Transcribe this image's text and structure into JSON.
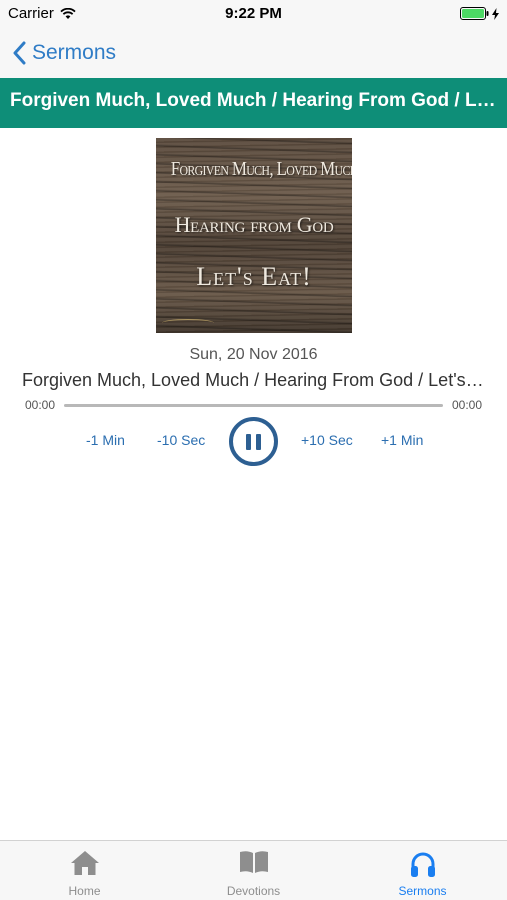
{
  "status_bar": {
    "carrier": "Carrier",
    "time": "9:22 PM",
    "battery_color": "#4cd964"
  },
  "nav": {
    "back_label": "Sermons",
    "accent_color": "#2f7cc6"
  },
  "banner": {
    "title": "Forgiven Much, Loved Much / Hearing From God / Let's Eat!",
    "background_color": "#0e8e78"
  },
  "artwork": {
    "line_1": "Forgiven Much, Loved Much",
    "line_2": "Hearing from God",
    "line_3": "Let's Eat!"
  },
  "sermon": {
    "date": "Sun, 20 Nov 2016",
    "title": "Forgiven Much, Loved Much / Hearing From God / Let's Eat!"
  },
  "player": {
    "elapsed": "00:00",
    "total": "00:00",
    "progress": 0,
    "state": "playing",
    "controls": {
      "back_1min": "-1 Min",
      "back_10": "-10 Sec",
      "fwd_10": "+10 Sec",
      "fwd_1min": "+1 Min"
    }
  },
  "tab_bar": {
    "active_tab": "sermons",
    "active_color": "#1a7ef0",
    "tabs": [
      {
        "label": "Home",
        "icon": "home-icon"
      },
      {
        "label": "Devotions",
        "icon": "book-icon"
      },
      {
        "label": "Sermons",
        "icon": "headphones-icon"
      }
    ]
  }
}
